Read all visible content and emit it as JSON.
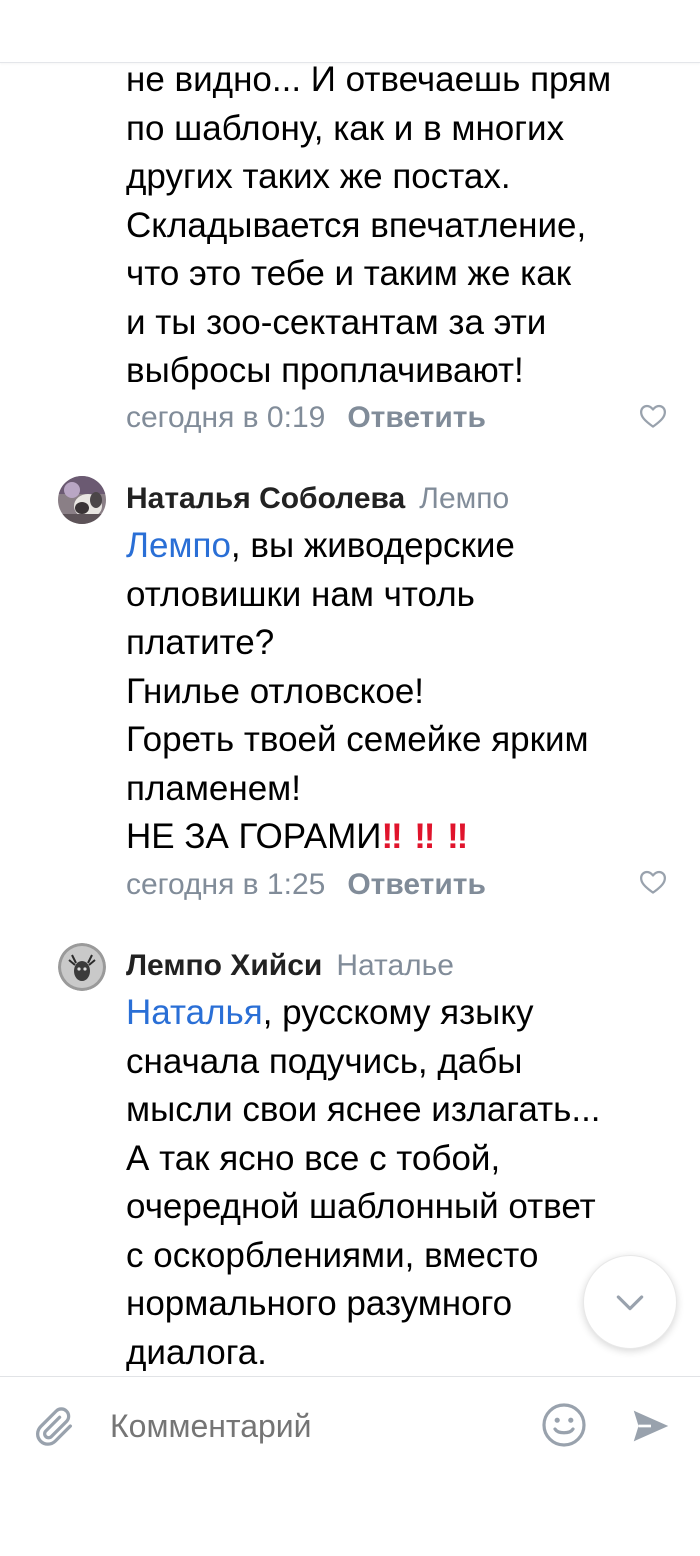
{
  "comments": [
    {
      "lines": [
        "не видно... И отвечаешь прям",
        "по шаблону, как и в многих",
        "других таких же постах.",
        "Складывается впечатление,",
        "что это тебе и таким же как",
        "и ты зоо-сектантам за эти",
        "выбросы проплачивают!"
      ],
      "time": "сегодня в 0:19",
      "reply_label": "Ответить"
    },
    {
      "author": "Наталья Соболева",
      "reply_to": "Лемпо",
      "mention": "Лемпо",
      "first_line_rest": ", вы живодерские",
      "lines": [
        "отловишки нам чтоль",
        "платите?",
        "Гнилье отловское!",
        "Гореть твоей семейке ярким",
        "пламенем!"
      ],
      "last_line_text": "НЕ ЗА ГОРАМИ",
      "last_line_emoji": "‼ ‼ ‼",
      "time": "сегодня в 1:25",
      "reply_label": "Ответить"
    },
    {
      "author": "Лемпо Хийси",
      "reply_to": "Наталье",
      "mention": "Наталья",
      "first_line_rest": ", русскому языку",
      "lines": [
        "сначала подучись, дабы",
        "мысли свои яснее излагать...",
        "А так ясно все с тобой,",
        "очередной шаблонный ответ",
        "с оскорблениями, вместо",
        "нормального разумного",
        "диалога."
      ]
    }
  ],
  "composer": {
    "placeholder": "Комментарий"
  },
  "icons": {
    "attach": "paperclip-icon",
    "emoji": "smile-icon",
    "send": "send-icon",
    "like": "heart-icon",
    "scroll": "chevron-down-icon"
  },
  "colors": {
    "accent": "#2a6fd6",
    "secondary": "#818c99",
    "alert": "#e0142c"
  }
}
